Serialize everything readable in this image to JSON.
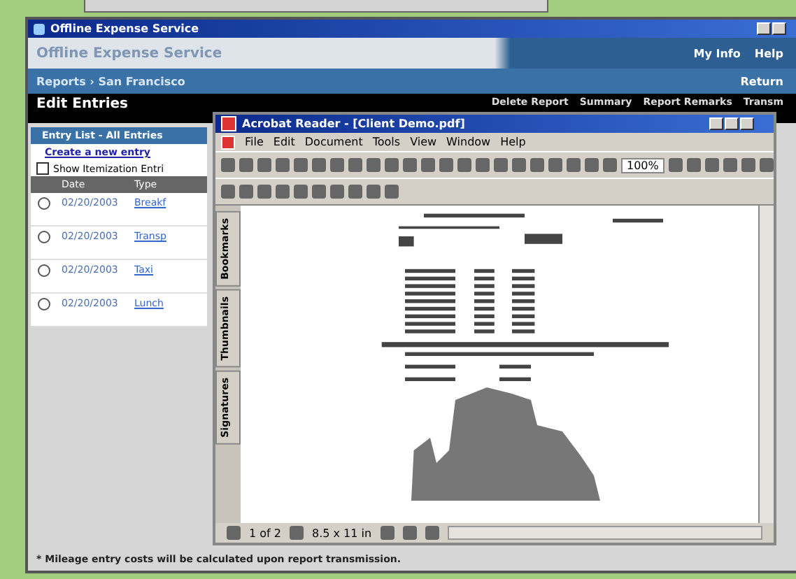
{
  "main_window": {
    "title": "Offline Expense Service"
  },
  "header": {
    "app_title": "Offline Expense Service",
    "links": [
      "My Info",
      "Help"
    ],
    "breadcrumb": "Reports › San Francisco",
    "return_link": "Return"
  },
  "action_bar": {
    "title": "Edit Entries",
    "actions": [
      "Delete Report",
      "Summary",
      "Report Remarks",
      "Transm"
    ]
  },
  "entry_panel": {
    "title": "Entry List - All Entries",
    "create_link": "Create a new entry",
    "option": {
      "label": "Show Itemization Entri",
      "checked": false
    },
    "columns": [
      "Date",
      "Type"
    ],
    "rows": [
      {
        "date": "02/20/2003",
        "type": "Breakf",
        "selected": false
      },
      {
        "date": "02/20/2003",
        "type": "Transp",
        "selected": false
      },
      {
        "date": "02/20/2003",
        "type": "Taxi",
        "selected": false
      },
      {
        "date": "02/20/2003",
        "type": "Lunch",
        "selected": false
      }
    ]
  },
  "footnote": "* Mileage entry costs will be calculated upon report transmission.",
  "reader_window": {
    "title": "Acrobat Reader - [Client Demo.pdf]",
    "menu": [
      "File",
      "Edit",
      "Document",
      "Tools",
      "View",
      "Window",
      "Help"
    ],
    "zoom": "100%",
    "side_tabs": [
      "Bookmarks",
      "Thumbnails",
      "Signatures"
    ],
    "page_indicator": "1 of 2",
    "page_size": "8.5 x 11 in"
  }
}
